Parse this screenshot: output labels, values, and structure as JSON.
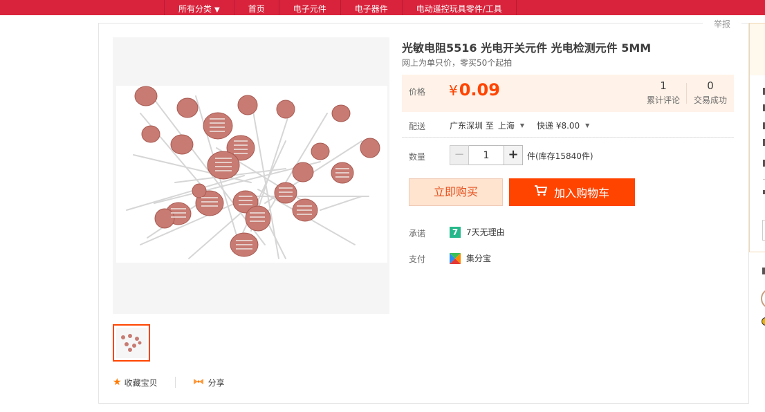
{
  "nav": {
    "items": [
      {
        "label": "所有分类",
        "has_arrow": true
      },
      {
        "label": "首页"
      },
      {
        "label": "电子元件"
      },
      {
        "label": "电子器件"
      },
      {
        "label": "电动遥控玩具零件/工具"
      }
    ],
    "arrow": "▼",
    "bg_color": "#d9233c"
  },
  "report_label": "举报",
  "product": {
    "title": "光敏电阻5516 光电开关元件 光电检测元件 5MM",
    "subtitle": "网上为单只价，零买50个起拍"
  },
  "price": {
    "label": "价格",
    "currency": "¥",
    "value": "0.09",
    "reviews_count": "1",
    "reviews_label": "累计评论",
    "deals_count": "0",
    "deals_label": "交易成功",
    "color": "#ff4400"
  },
  "shipping": {
    "label": "配送",
    "from": "广东深圳 至",
    "to": "上海",
    "method": "快递 ¥8.00"
  },
  "quantity": {
    "label": "数量",
    "minus": "−",
    "plus": "+",
    "value": "1",
    "stock_text": "件(库存15840件)"
  },
  "buttons": {
    "buy_now": "立即购买",
    "add_cart": "加入购物车"
  },
  "promise": {
    "label": "承诺",
    "badge": "7",
    "text": "7天无理由"
  },
  "payment": {
    "label": "支付",
    "text": "集分宝"
  },
  "actions": {
    "favorite": "收藏宝贝",
    "share": "分享"
  },
  "icons": [
    "star-icon",
    "share-icon",
    "cart-icon",
    "seven-day-icon",
    "jifenbao-icon",
    "dropdown-arrow-icon"
  ]
}
